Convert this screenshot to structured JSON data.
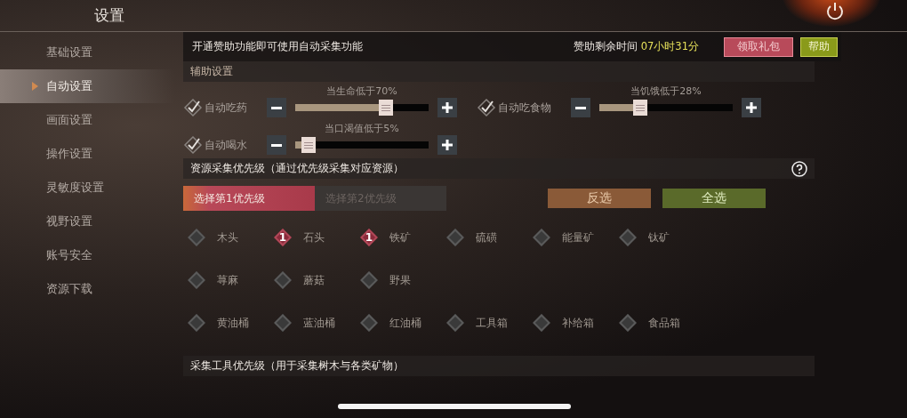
{
  "title": "设置",
  "sidebar": {
    "items": [
      {
        "label": "基础设置",
        "selected": false
      },
      {
        "label": "自动设置",
        "selected": true
      },
      {
        "label": "画面设置",
        "selected": false
      },
      {
        "label": "操作设置",
        "selected": false
      },
      {
        "label": "灵敏度设置",
        "selected": false
      },
      {
        "label": "视野设置",
        "selected": false
      },
      {
        "label": "账号安全",
        "selected": false
      },
      {
        "label": "资源下载",
        "selected": false
      }
    ]
  },
  "sponsor_bar": {
    "notice": "开通赞助功能即可使用自动采集功能",
    "remaining_label": "赞助剩余时间",
    "remaining_value": "07小时31分",
    "buttons": [
      {
        "label": "领取礼包",
        "kind": "gift"
      },
      {
        "label": "帮助",
        "kind": "help"
      }
    ]
  },
  "assist": {
    "title": "辅助设置",
    "rows": [
      [
        {
          "label": "自动吃药",
          "checked": true,
          "caption": "当生命低于70%",
          "level": 0.7
        },
        {
          "label": "自动吃食物",
          "checked": true,
          "caption": "当饥饿低于28%",
          "level": 0.28
        }
      ],
      [
        {
          "label": "自动喝水",
          "checked": true,
          "caption": "当口渴值低于5%",
          "level": 0.05
        }
      ]
    ]
  },
  "resources": {
    "title": "资源采集优先级（通过优先级采集对应资源）",
    "tabs": [
      {
        "label": "选择第1优先级",
        "selected": true
      },
      {
        "label": "选择第2优先级",
        "selected": false
      }
    ],
    "actions": [
      {
        "label": "反选",
        "kind": "invert"
      },
      {
        "label": "全选",
        "kind": "all"
      }
    ],
    "rows": [
      [
        {
          "name": "木头",
          "selected": false
        },
        {
          "name": "石头",
          "selected": true,
          "priority": "1"
        },
        {
          "name": "铁矿",
          "selected": true,
          "priority": "1"
        },
        {
          "name": "硫磺",
          "selected": false
        },
        {
          "name": "能量矿",
          "selected": false
        },
        {
          "name": "钛矿",
          "selected": false
        }
      ],
      [
        {
          "name": "荨麻",
          "selected": false
        },
        {
          "name": "蘑菇",
          "selected": false
        },
        {
          "name": "野果",
          "selected": false
        }
      ],
      [
        {
          "name": "黄油桶",
          "selected": false
        },
        {
          "name": "蓝油桶",
          "selected": false
        },
        {
          "name": "红油桶",
          "selected": false
        },
        {
          "name": "工具箱",
          "selected": false
        },
        {
          "name": "补给箱",
          "selected": false
        },
        {
          "name": "食品箱",
          "selected": false
        }
      ]
    ]
  },
  "tools": {
    "title": "采集工具优先级（用于采集树木与各类矿物）"
  }
}
